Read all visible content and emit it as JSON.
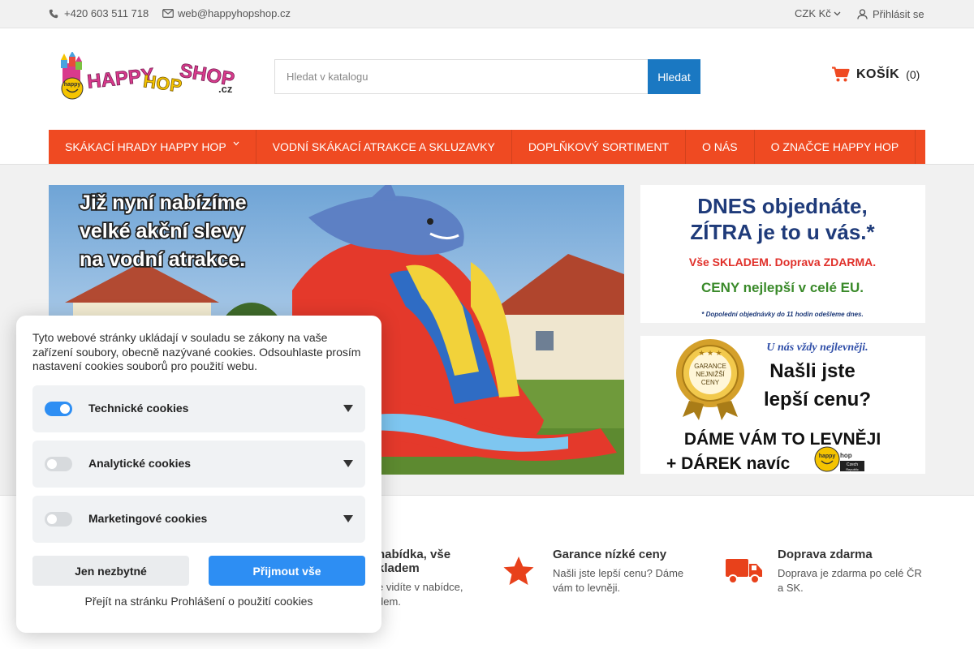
{
  "topbar": {
    "phone": "+420 603 511 718",
    "email": "web@happyhopshop.cz",
    "currency": "CZK Kč",
    "login": "Přihlásit se"
  },
  "header": {
    "logo_text_happy": "HAPPY",
    "logo_text_hop": "HOP",
    "logo_text_shop": "SHOP",
    "logo_text_cz": ".cz",
    "logo_badge": "happy",
    "search_placeholder": "Hledat v katalogu",
    "search_button": "Hledat",
    "cart_label": "KOŠÍK",
    "cart_count": "(0)"
  },
  "nav": {
    "items": [
      {
        "label": "SKÁKACÍ HRADY HAPPY HOP"
      },
      {
        "label": "VODNÍ SKÁKACÍ ATRAKCE A SKLUZAVKY"
      },
      {
        "label": "DOPLŇKOVÝ SORTIMENT"
      },
      {
        "label": "O NÁS"
      },
      {
        "label": "O ZNAČCE HAPPY HOP"
      }
    ]
  },
  "banners": {
    "main_line1": "Již nyní nabízíme",
    "main_line2": "velké akční slevy",
    "main_line3": "na vodní atrakce.",
    "side1_line1": "DNES objednáte,",
    "side1_line2": "ZÍTRA je to u vás.*",
    "side1_line3": "Vše SKLADEM. Doprava ZDARMA.",
    "side1_line4": "CENY nejlepší v celé EU.",
    "side1_note": "* Dopolední objednávky do 11 hodin odešleme dnes.",
    "side2_top": "U nás vždy nejlevněji.",
    "side2_seal1": "GARANCE",
    "side2_seal2": "NEJNIŽŠÍ",
    "side2_seal3": "CENY",
    "side2_line1": "Našli jste",
    "side2_line2": "lepší cenu?",
    "side2_line3": "DÁME VÁM TO LEVNĚJI",
    "side2_line4": "+ DÁREK navíc",
    "side2_logo_happy": "happy",
    "side2_logo_hop": "hop",
    "side2_logo_sub1": "Czech",
    "side2_logo_sub2": "Republic"
  },
  "features": [
    {
      "title_line1": "nabídka, vše",
      "title_line2": "kladem",
      "desc_line1": "e vidíte v nabídce,",
      "desc_line2": "dem."
    },
    {
      "title_line1": "Garance nízké ceny",
      "desc_line1": "Našli jste lepší cenu? Dáme",
      "desc_line2": "vám to levněji."
    },
    {
      "title_line1": "Doprava zdarma",
      "desc_line1": "Doprava je zdarma po celé ČR",
      "desc_line2": "a SK."
    }
  ],
  "cookie": {
    "intro": "Tyto webové stránky ukládají v souladu se zákony na vaše zařízení soubory, obecně nazývané cookies. Odsouhlaste prosím nastavení cookies souborů pro použití webu.",
    "categories": [
      {
        "label": "Technické cookies",
        "enabled": true
      },
      {
        "label": "Analytické cookies",
        "enabled": false
      },
      {
        "label": "Marketingové cookies",
        "enabled": false
      }
    ],
    "btn_necessary": "Jen nezbytné",
    "btn_accept": "Přijmout vše",
    "policy_link": "Přejít na stránku Prohlášení o použití cookies"
  },
  "colors": {
    "nav_bg": "#ef4a22",
    "search_button": "#1a78c2",
    "cookie_accent": "#2d8ef3",
    "feature_icon": "#e8411b"
  }
}
